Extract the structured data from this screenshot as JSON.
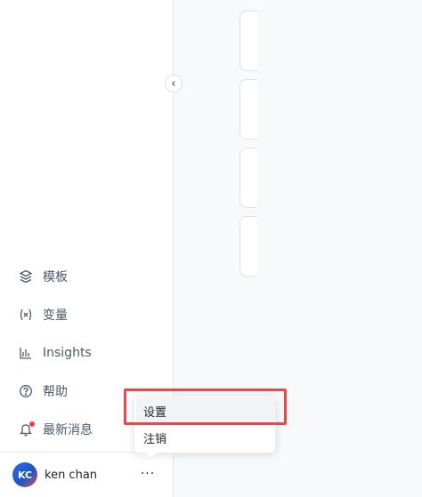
{
  "nav": {
    "items": [
      {
        "label": "模板",
        "icon": "template-icon"
      },
      {
        "label": "变量",
        "icon": "variable-icon"
      },
      {
        "label": "Insights",
        "icon": "bar-chart-icon"
      },
      {
        "label": "帮助",
        "icon": "help-icon"
      },
      {
        "label": "最新消息",
        "icon": "bell-icon"
      }
    ]
  },
  "user": {
    "initials": "KC",
    "name": "ken chan",
    "more_label": "···"
  },
  "menu": {
    "items": [
      {
        "label": "设置"
      },
      {
        "label": "注销"
      }
    ]
  },
  "colors": {
    "highlight": "#e5484d",
    "notification_dot": "#f5413f",
    "avatar_blue": "#2d6fe8"
  }
}
